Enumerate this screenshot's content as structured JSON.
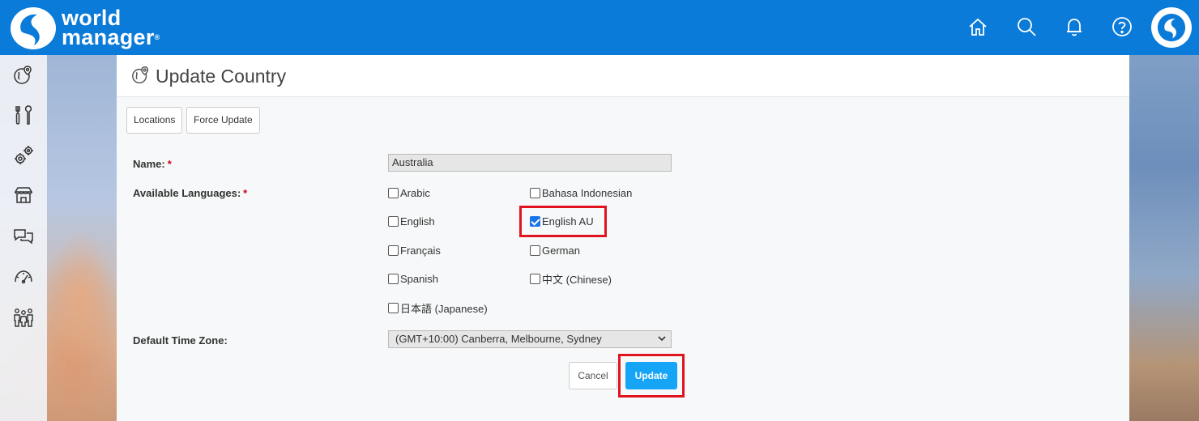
{
  "brand": {
    "line1": "world",
    "line2": "manager",
    "reg": "®",
    "primary_color": "#0a7bd8"
  },
  "header": {
    "icons": [
      "home-icon",
      "search-icon",
      "bell-icon",
      "help-icon"
    ],
    "avatar_icon": "world-manager-mark-icon"
  },
  "sidebar": {
    "icons": [
      "map-pin-globe-icon",
      "tools-icon",
      "gears-icon",
      "store-icon",
      "chat-icon",
      "speedometer-icon",
      "people-icon"
    ]
  },
  "page": {
    "title": "Update Country",
    "tabs": [
      {
        "label": "Locations"
      },
      {
        "label": "Force Update"
      }
    ]
  },
  "form": {
    "name_label": "Name:",
    "name_value": "Australia",
    "languages_label": "Available Languages:",
    "required_mark": "*",
    "languages": [
      {
        "label": "Arabic",
        "checked": false
      },
      {
        "label": "Bahasa Indonesian",
        "checked": false
      },
      {
        "label": "English",
        "checked": false
      },
      {
        "label": "English AU",
        "checked": true
      },
      {
        "label": "Français",
        "checked": false
      },
      {
        "label": "German",
        "checked": false
      },
      {
        "label": "Spanish",
        "checked": false
      },
      {
        "label": "中文 (Chinese)",
        "checked": false
      },
      {
        "label": "日本語 (Japanese)",
        "checked": false
      }
    ],
    "timezone_label": "Default Time Zone:",
    "timezone_value": "(GMT+10:00) Canberra, Melbourne, Sydney",
    "cancel_label": "Cancel",
    "update_label": "Update",
    "highlight_color": "#e0141e",
    "update_color": "#16a4f7"
  }
}
